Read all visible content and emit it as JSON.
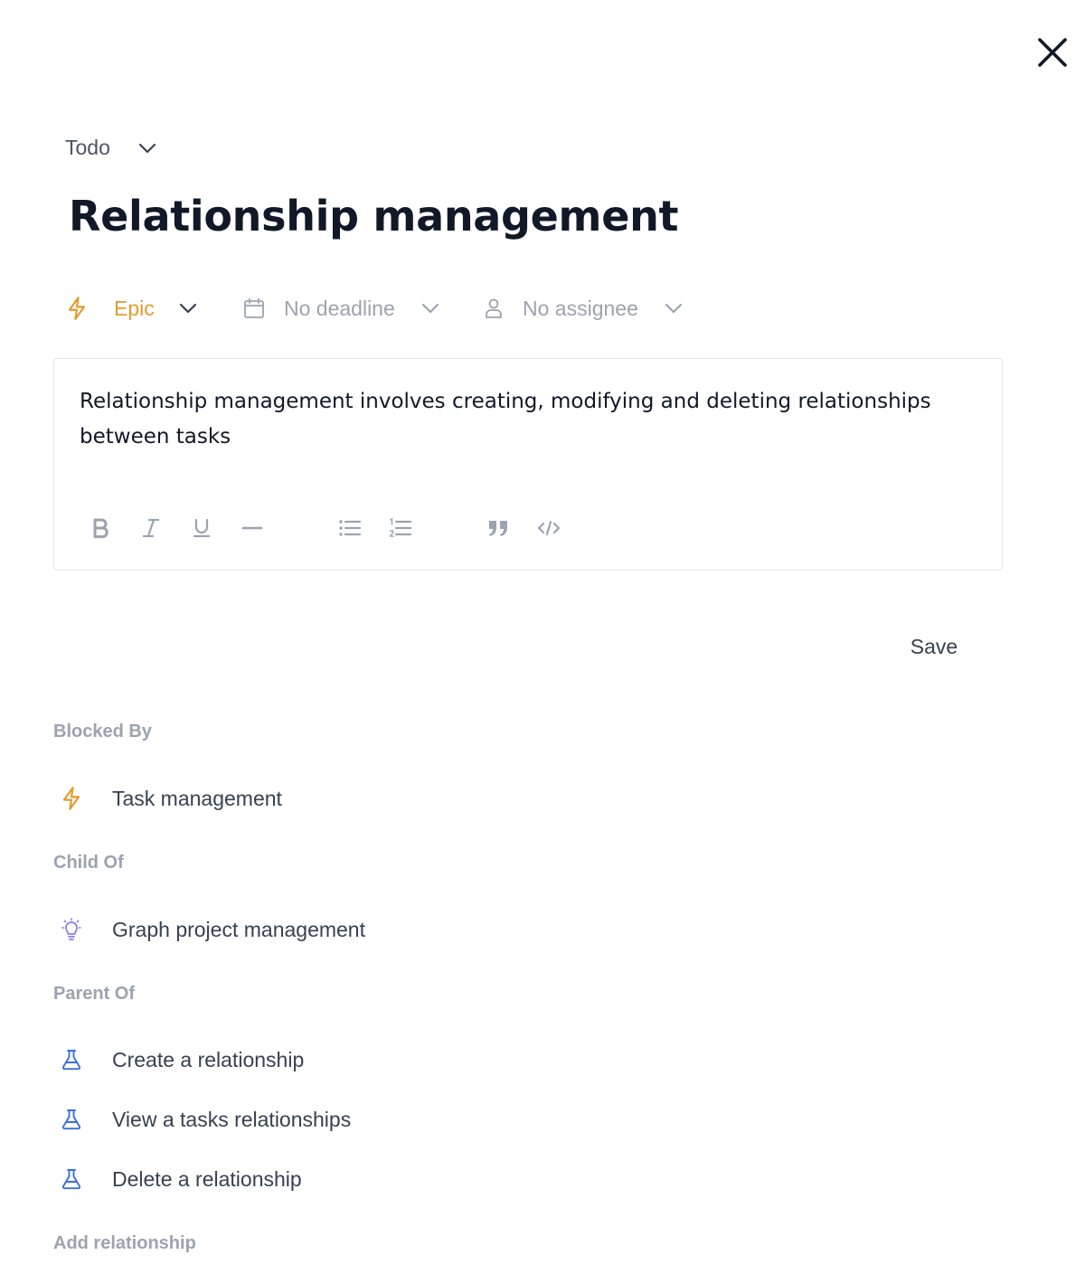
{
  "status": {
    "label": "Todo"
  },
  "task": {
    "title": "Relationship management",
    "description": "Relationship management involves creating, modifying and deleting relationships between tasks"
  },
  "attributes": {
    "type": {
      "label": "Epic",
      "icon": "lightning-icon",
      "color": "#e59a2e"
    },
    "deadline": {
      "label": "No deadline",
      "icon": "calendar-icon"
    },
    "assignee": {
      "label": "No assignee",
      "icon": "person-icon"
    }
  },
  "toolbar": {
    "tools": [
      "bold-icon",
      "italic-icon",
      "underline-icon",
      "horizontal-rule-icon",
      "bullet-list-icon",
      "numbered-list-icon",
      "blockquote-icon",
      "code-icon"
    ]
  },
  "save_label": "Save",
  "relationships": {
    "blocked_by": {
      "title": "Blocked By",
      "items": [
        {
          "label": "Task management",
          "icon": "lightning-icon"
        }
      ]
    },
    "child_of": {
      "title": "Child Of",
      "items": [
        {
          "label": "Graph project management",
          "icon": "lightbulb-icon"
        }
      ]
    },
    "parent_of": {
      "title": "Parent Of",
      "items": [
        {
          "label": "Create a relationship",
          "icon": "flask-icon"
        },
        {
          "label": "View a tasks relationships",
          "icon": "flask-icon"
        },
        {
          "label": "Delete a relationship",
          "icon": "flask-icon"
        }
      ]
    },
    "add_title": "Add relationship"
  },
  "colors": {
    "epic": "#e59a2e",
    "idea": "#8b7cf0",
    "story": "#3b6fd8",
    "muted": "#9ca3af"
  }
}
